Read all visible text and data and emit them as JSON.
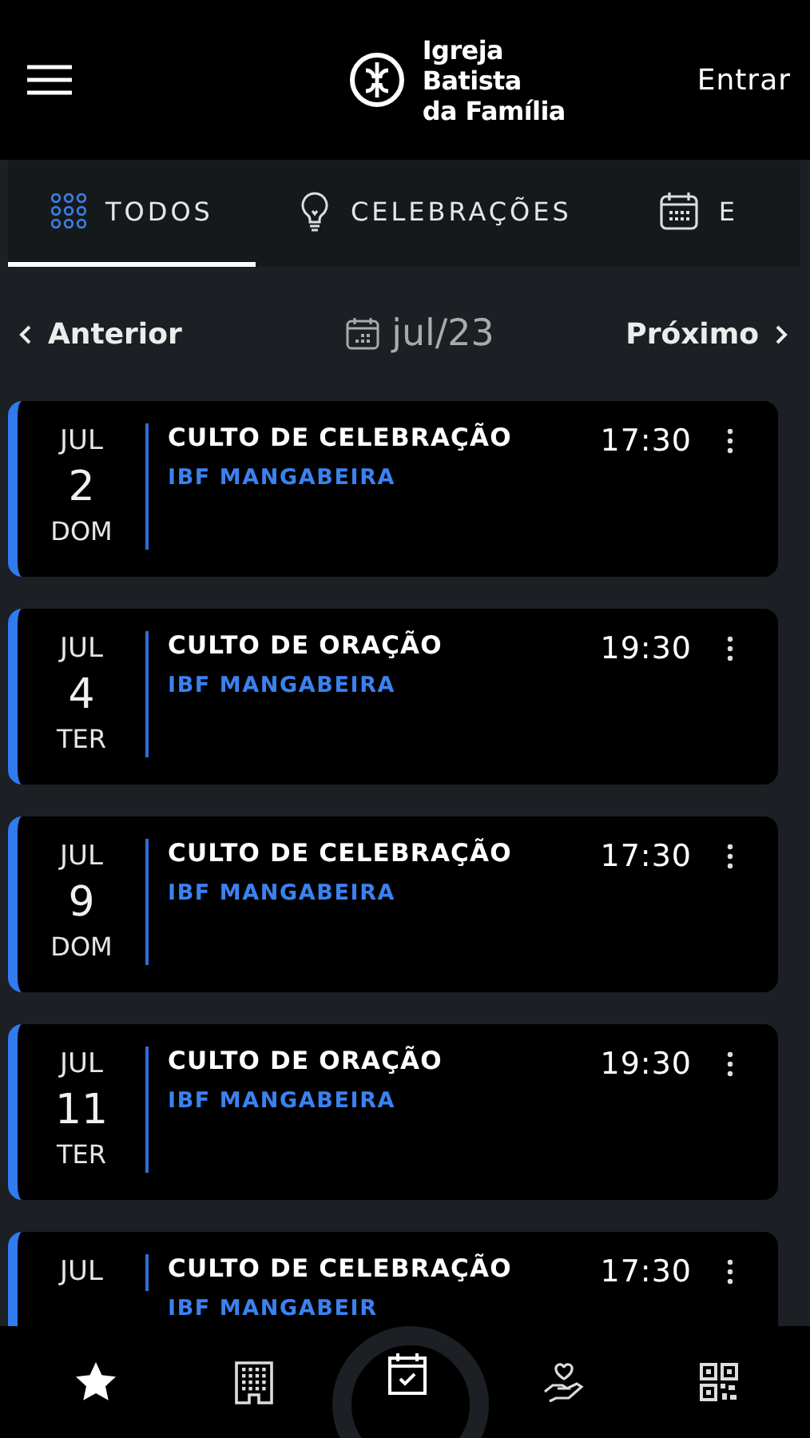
{
  "header": {
    "brand_lines": [
      "Igreja",
      "Batista",
      "da Família"
    ],
    "login": "Entrar"
  },
  "tabs": [
    {
      "kind": "grid",
      "label": "TODOS",
      "selected": true
    },
    {
      "kind": "bulb",
      "label": "CELEBRAÇÕES",
      "selected": false
    },
    {
      "kind": "calendar",
      "label": "E",
      "selected": false
    }
  ],
  "month_nav": {
    "previous": "Anterior",
    "month": "jul/23",
    "next": "Próximo"
  },
  "events": [
    {
      "month": "JUL",
      "day": "2",
      "weekday": "DOM",
      "title": "CULTO DE CELEBRAÇÃO",
      "location": "IBF MANGABEIRA",
      "time": "17:30"
    },
    {
      "month": "JUL",
      "day": "4",
      "weekday": "TER",
      "title": "CULTO DE ORAÇÃO",
      "location": "IBF MANGABEIRA",
      "time": "19:30"
    },
    {
      "month": "JUL",
      "day": "9",
      "weekday": "DOM",
      "title": "CULTO DE CELEBRAÇÃO",
      "location": "IBF MANGABEIRA",
      "time": "17:30"
    },
    {
      "month": "JUL",
      "day": "11",
      "weekday": "TER",
      "title": "CULTO DE ORAÇÃO",
      "location": "IBF MANGABEIRA",
      "time": "19:30"
    },
    {
      "month": "JUL",
      "title": "CULTO DE CELEBRAÇÃO",
      "location": "IBF MANGABEIR",
      "time": "17:30"
    }
  ]
}
